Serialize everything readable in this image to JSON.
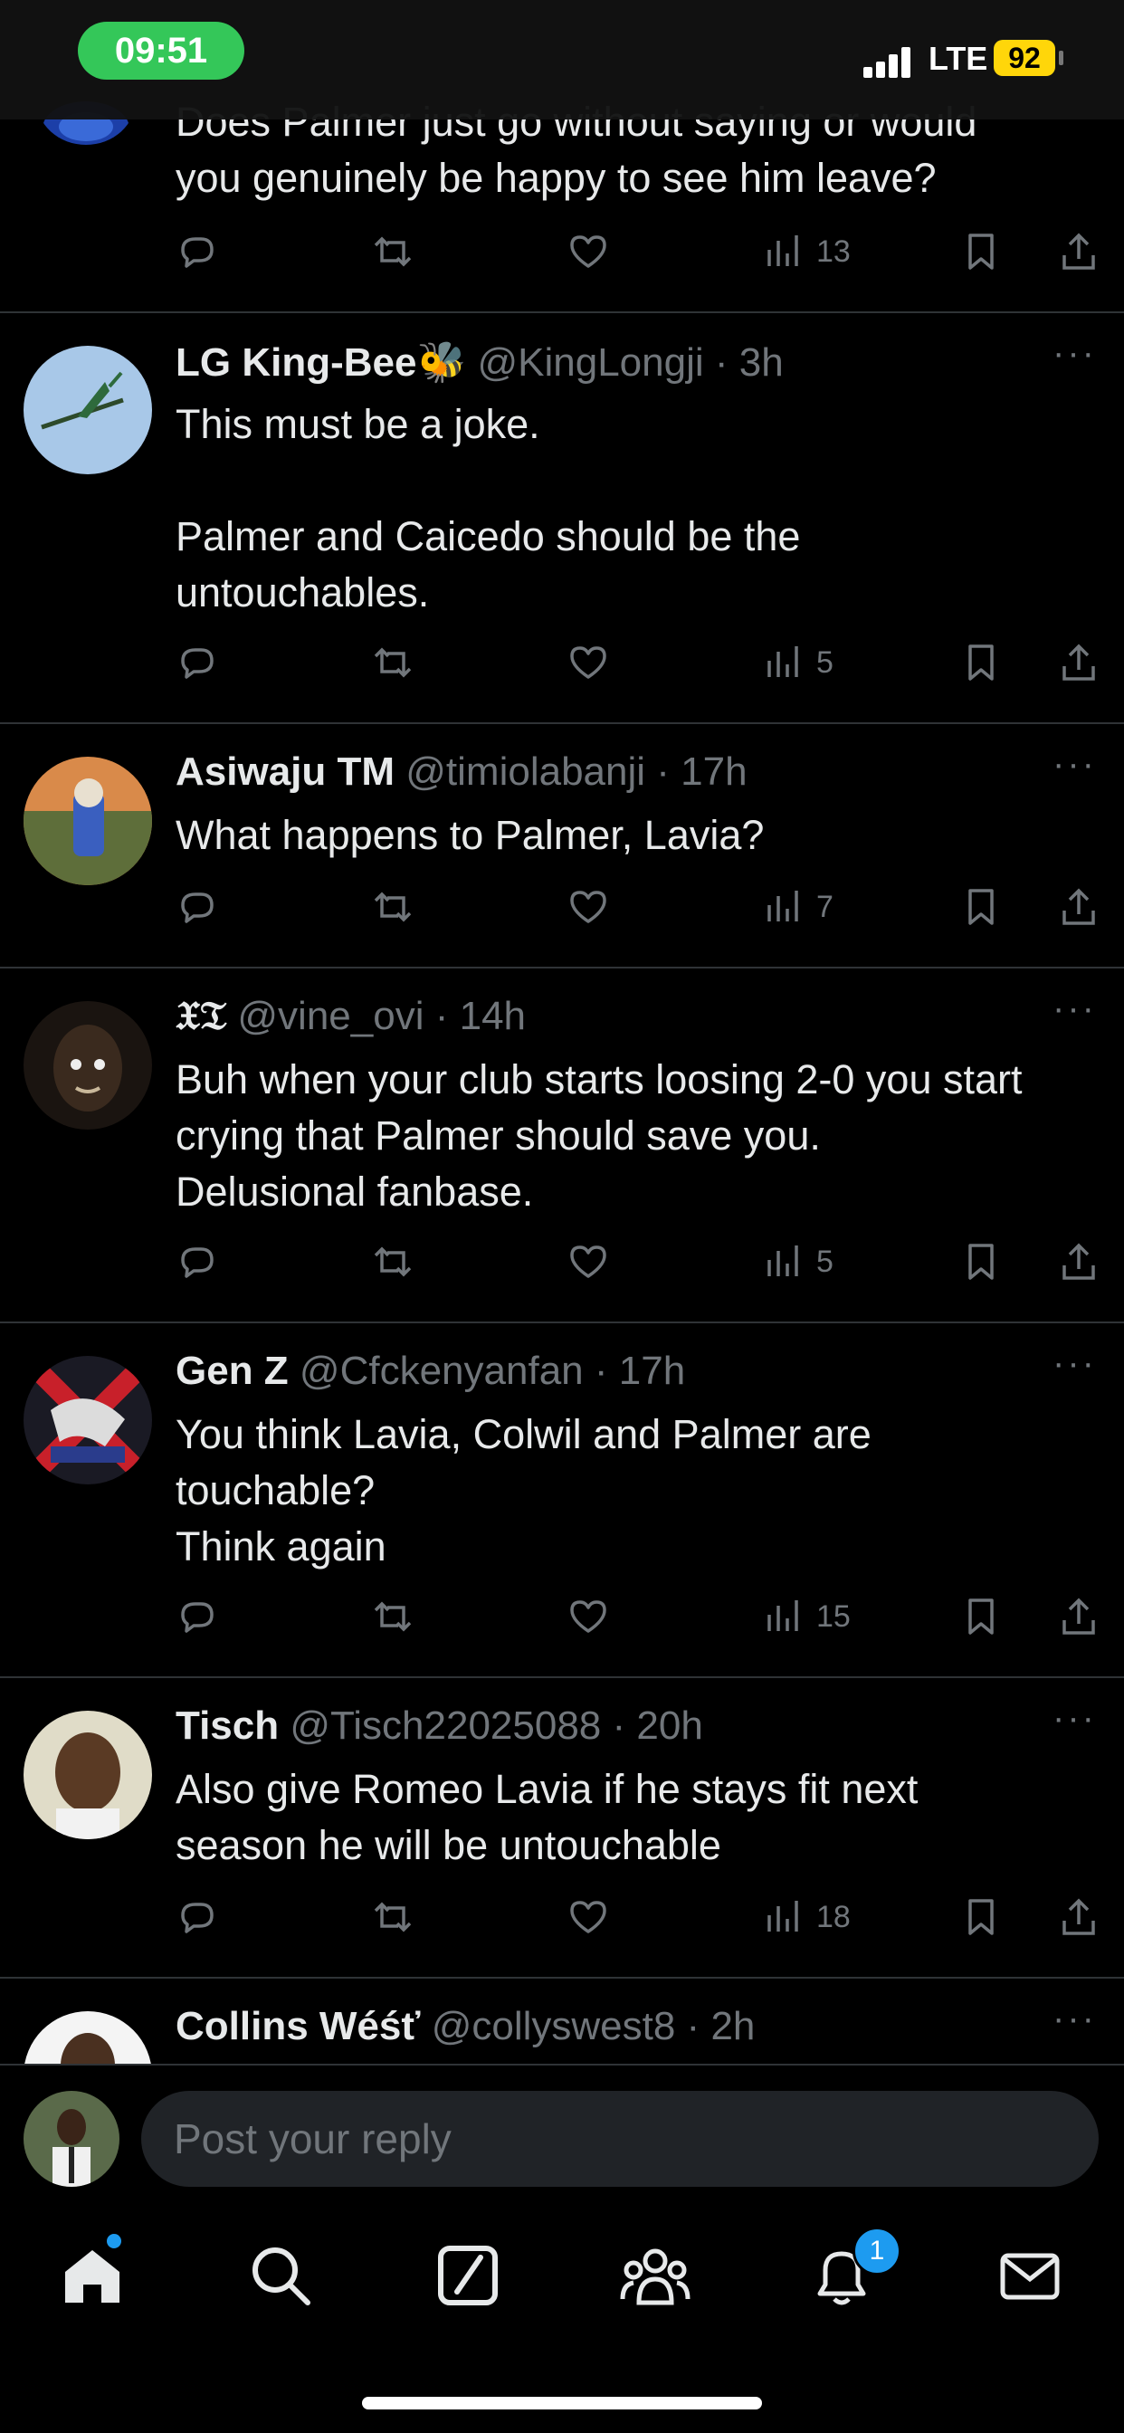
{
  "status_bar": {
    "time": "09:51",
    "network": "LTE",
    "battery": "92"
  },
  "tweets": [
    {
      "name": "",
      "handle": "",
      "time": "",
      "text": "Does Palmer just go without saying or would\nyou genuinely be happy to see him leave?",
      "views": "13"
    },
    {
      "name": "LG King-Bee🐝",
      "handle": "@KingLongji",
      "time": "3h",
      "text": "This must be a joke.\n\nPalmer and Caicedo should be the\nuntouchables.",
      "views": "5"
    },
    {
      "name": "Asiwaju TM",
      "handle": "@timiolabanji",
      "time": "17h",
      "text": "What happens to Palmer, Lavia?",
      "views": "7"
    },
    {
      "name": "𝔛𝔗",
      "handle": "@vine_ovi",
      "time": "14h",
      "text": "Buh when your club starts loosing 2-0 you start\ncrying that Palmer should save you.\nDelusional fanbase.",
      "views": "5"
    },
    {
      "name": "Gen Z",
      "handle": "@Cfckenyanfan",
      "time": "17h",
      "text": "You think Lavia, Colwil and Palmer are\ntouchable?\nThink again",
      "views": "15"
    },
    {
      "name": "Tisch",
      "handle": "@Tisch22025088",
      "time": "20h",
      "text": "Also give Romeo Lavia if he stays fit next\nseason he will be untouchable",
      "views": "18"
    },
    {
      "name": "Collins Wéśť",
      "handle": "@collyswest8",
      "time": "2h",
      "text": "",
      "views": ""
    }
  ],
  "reply": {
    "placeholder": "Post your reply"
  },
  "tabbar": {
    "notifications_badge": "1"
  },
  "colors": {
    "accent": "#1d9bf0",
    "background": "#000000",
    "muted": "#71767b",
    "time_pill": "#34c759",
    "battery": "#ffd60a"
  }
}
